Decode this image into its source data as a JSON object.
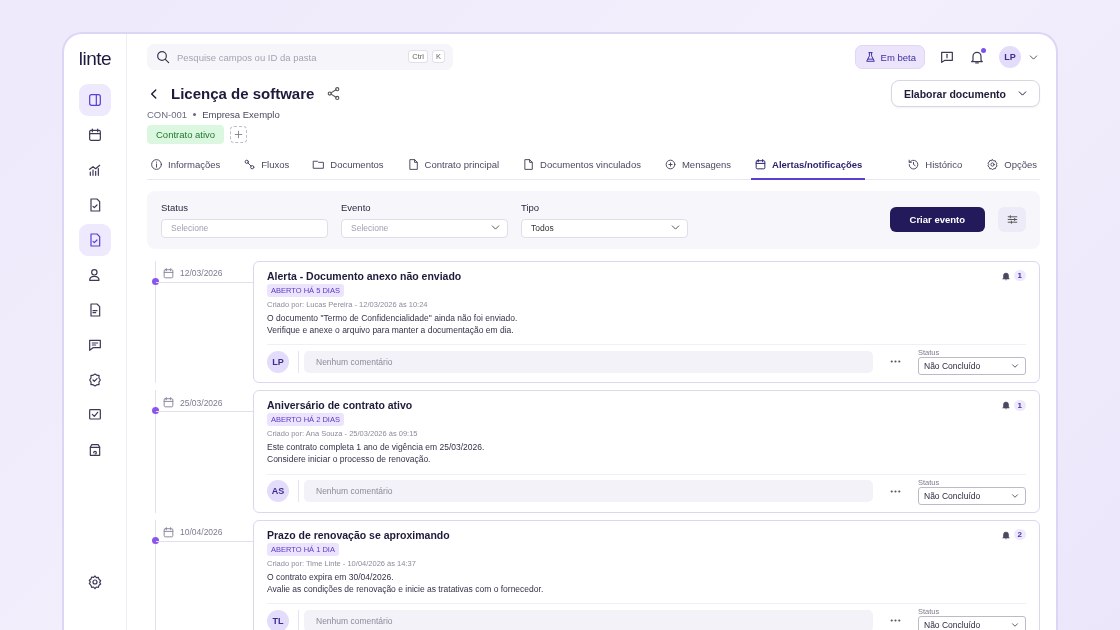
{
  "brand": {
    "logo": "linte"
  },
  "search": {
    "placeholder": "Pesquise campos ou ID da pasta",
    "shortcut": [
      "Ctrl",
      "K"
    ]
  },
  "header": {
    "beta": "Em beta",
    "unread": true,
    "avatar": "LP"
  },
  "sidebar": {
    "items": [
      {
        "kind": "panel",
        "selected": true
      },
      {
        "kind": "calendar",
        "selected": false
      },
      {
        "kind": "chart",
        "selected": false
      },
      {
        "kind": "doc-check",
        "selected": false
      },
      {
        "kind": "doc-check",
        "selected": true
      },
      {
        "kind": "user",
        "selected": false
      },
      {
        "kind": "doc-lines",
        "selected": false
      },
      {
        "kind": "message",
        "selected": false
      },
      {
        "kind": "badge-check",
        "selected": false
      },
      {
        "kind": "checkbox",
        "selected": false
      },
      {
        "kind": "archive",
        "selected": false
      }
    ]
  },
  "page": {
    "title": "Licença de software",
    "code": "CON-001",
    "company": "Empresa Exemplo",
    "status_tag": "Contrato ativo",
    "action": "Elaborar documento"
  },
  "tabs": [
    {
      "label": "Informações",
      "selected": false
    },
    {
      "label": "Fluxos",
      "selected": false
    },
    {
      "label": "Documentos",
      "selected": false
    },
    {
      "label": "Contrato principal",
      "selected": false
    },
    {
      "label": "Documentos vinculados",
      "selected": false
    },
    {
      "label": "Mensagens",
      "selected": false
    },
    {
      "label": "Alertas/notificações",
      "selected": true
    }
  ],
  "side_tabs": [
    {
      "label": "Histórico"
    },
    {
      "label": "Opções"
    }
  ],
  "filters": {
    "fields": [
      {
        "label": "Status",
        "placeholder": "Selecione",
        "kind": "text"
      },
      {
        "label": "Evento",
        "placeholder": "Selecione",
        "kind": "select"
      },
      {
        "label": "Tipo",
        "value": "Todos",
        "kind": "select"
      }
    ],
    "create": "Criar evento"
  },
  "events": [
    {
      "date": "12/03/2026",
      "title": "Alerta - Documento anexo não enviado",
      "badge": "ABERTO HÁ 5 DIAS",
      "created": "Criado por: Lucas Pereira - 12/03/2026 às 10:24",
      "body": [
        "O documento \"Termo de Confidencialidade\" ainda não foi enviado.",
        "Verifique e anexe o arquivo para manter a documentação em dia."
      ],
      "count": "1",
      "avatar": "LP",
      "comment_placeholder": "Nenhum comentário",
      "status_label": "Status",
      "status": "Não Concluído"
    },
    {
      "date": "25/03/2026",
      "title": "Aniversário de contrato ativo",
      "badge": "ABERTO HÁ 2 DIAS",
      "created": "Criado por: Ana Souza - 25/03/2026 às 09:15",
      "body": [
        "Este contrato completa 1 ano de vigência em 25/03/2026.",
        "Considere iniciar o processo de renovação."
      ],
      "count": "1",
      "avatar": "AS",
      "comment_placeholder": "Nenhum comentário",
      "status_label": "Status",
      "status": "Não Concluído"
    },
    {
      "date": "10/04/2026",
      "title": "Prazo de renovação se aproximando",
      "badge": "ABERTO HÁ 1 DIA",
      "created": "Criado por: Time Linte - 10/04/2026 às 14:37",
      "body": [
        "O contrato expira em 30/04/2026.",
        "Avalie as condições de renovação e inicie as tratativas com o fornecedor."
      ],
      "count": "2",
      "avatar": "TL",
      "comment_placeholder": "Nenhum comentário",
      "status_label": "Status",
      "status": "Não Concluído"
    }
  ]
}
